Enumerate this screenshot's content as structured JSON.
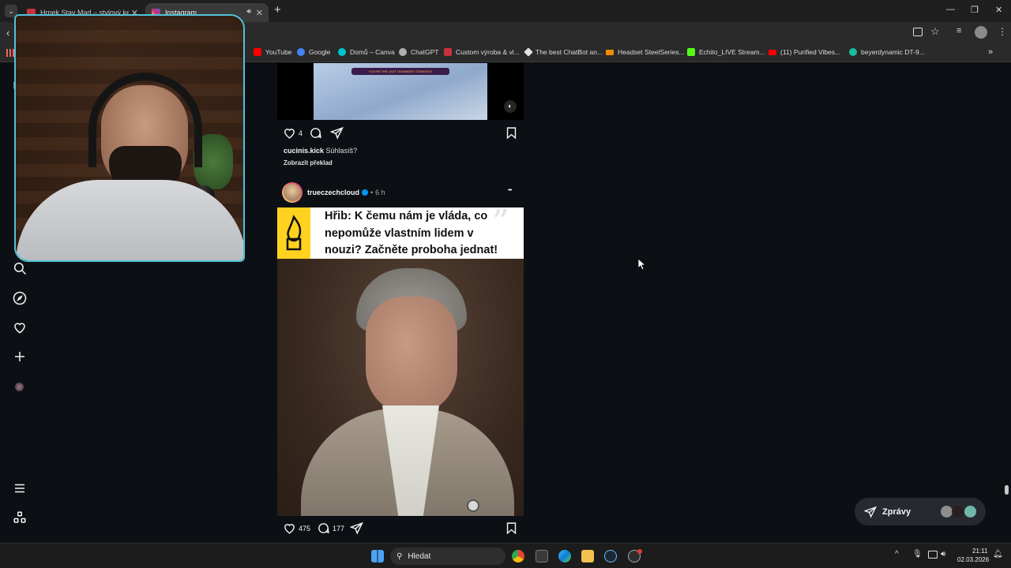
{
  "browser": {
    "tabs": [
      {
        "title": "Hrnek Stay Mad – stylový kerami",
        "active": false,
        "fav_color": "#c8323c"
      },
      {
        "title": "Instagram",
        "active": true,
        "fav_color": "#d62976"
      }
    ],
    "window_controls": {
      "minimize": "—",
      "maximize": "❐",
      "close": "✕"
    },
    "new_tab": "+",
    "bookmarks": [
      {
        "label": "YouTube",
        "color": "#ff0000"
      },
      {
        "label": "Google",
        "color": "#4285f4"
      },
      {
        "label": "Domů – Canva",
        "color": "#00c4cc"
      },
      {
        "label": "ChatGPT",
        "color": "#b0b0b0"
      },
      {
        "label": "Custom výroba & vl...",
        "color": "#c8323c"
      },
      {
        "label": "The best ChatBot an...",
        "color": "#e0e0e0"
      },
      {
        "label": "Headset SteelSeries...",
        "color": "#f08c00"
      },
      {
        "label": "Echito_LIVE Stream...",
        "color": "#53fc18"
      },
      {
        "label": "(11) Purified Vibes...",
        "color": "#ff0000"
      },
      {
        "label": "beyerdynamic DT-9...",
        "color": "#1abc9c"
      }
    ],
    "more_bookmarks": "»"
  },
  "post1": {
    "video_banner": "YOU'RE THE LAST TEAMMATE STANDING!",
    "likes": "4",
    "username": "cucinis.kick",
    "caption": "Súhlasíš?",
    "translate": "Zobrazit překlad"
  },
  "post2": {
    "username": "trueczechcloud",
    "time": "6 h",
    "separator": "•",
    "more": "•••",
    "headline": "Hřib: K čemu nám  je vláda, co nepomůže vlastním lidem v nouzi? Začněte proboha jednat!",
    "likes": "475",
    "comments": "177"
  },
  "messages": {
    "label": "Zprávy"
  },
  "taskbar": {
    "search_placeholder": "Hledat",
    "time": "21:11",
    "date": "02.03.2026"
  },
  "colors": {
    "bg": "#0c1014",
    "accent_yellow": "#ffd21f",
    "webcam_border": "#4fc3d9",
    "verified": "#0095f6"
  }
}
